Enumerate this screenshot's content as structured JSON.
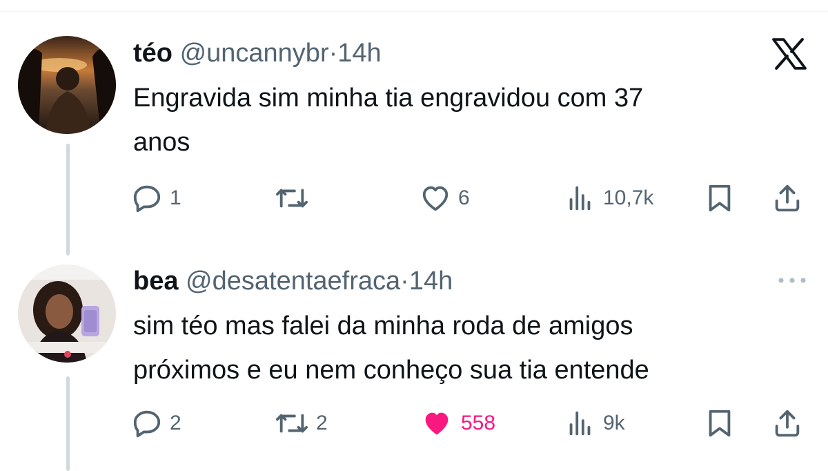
{
  "tweets": [
    {
      "name": "téo",
      "handle": "@uncannybr",
      "separator": "·",
      "time": "14h",
      "text_line1": "Engravida sim minha tia engravidou com 37",
      "text_line2": "anos",
      "replies": "1",
      "retweets": "",
      "likes": "6",
      "liked": false,
      "views": "10,7k"
    },
    {
      "name": "bea",
      "handle": "@desatentaefraca",
      "separator": "·",
      "time": "14h",
      "text_line1": "sim téo mas falei da minha roda de amigos",
      "text_line2": "próximos e eu nem conheço sua tia entende",
      "replies": "2",
      "retweets": "2",
      "likes": "558",
      "liked": true,
      "views": "9k"
    }
  ],
  "colors": {
    "text": "#0f1419",
    "secondary": "#536471",
    "like_active": "#f91880",
    "thread_line": "#cfd9de"
  },
  "icons": [
    "x-logo-icon",
    "more-options-icon",
    "reply-icon",
    "retweet-icon",
    "like-icon",
    "views-icon",
    "bookmark-icon",
    "share-icon"
  ]
}
